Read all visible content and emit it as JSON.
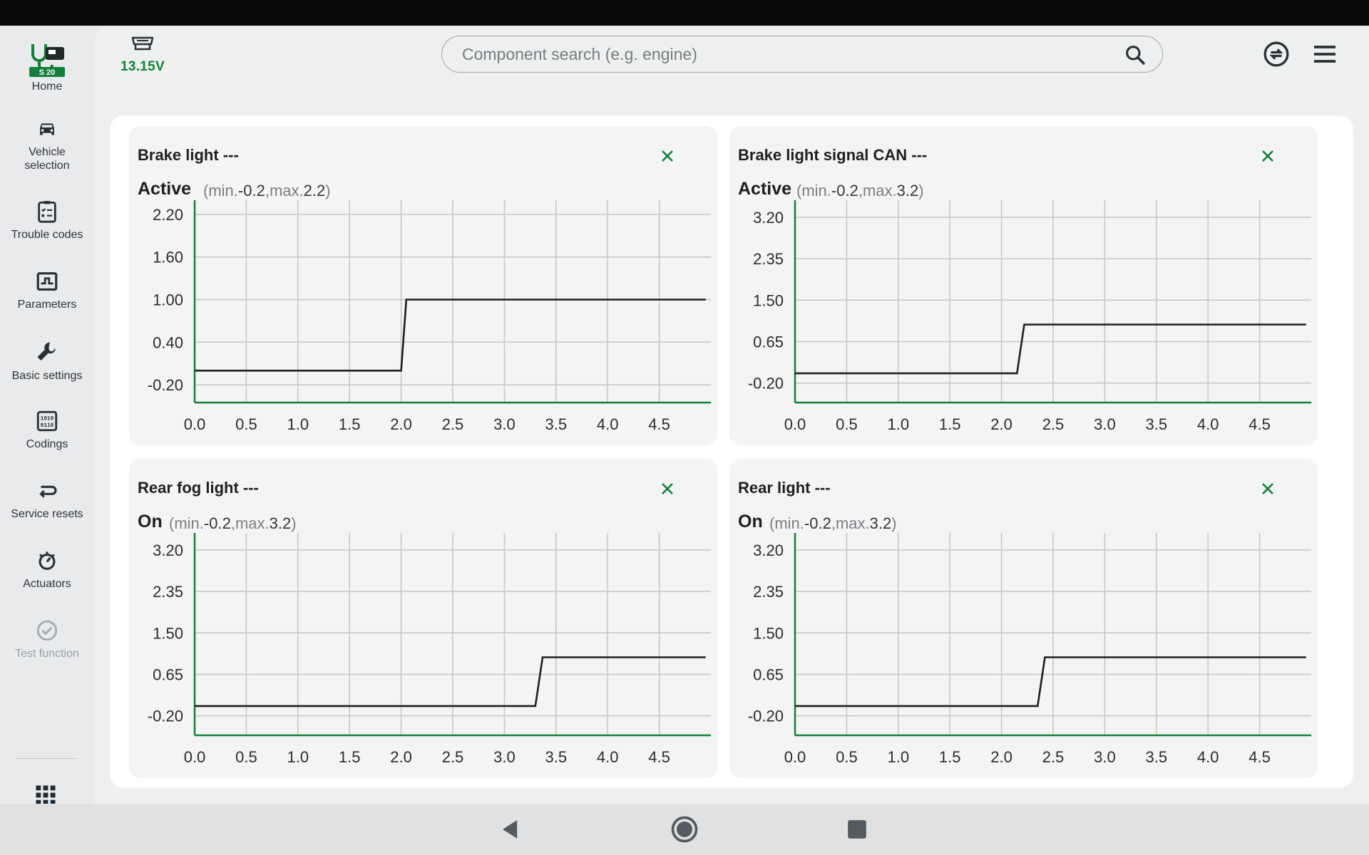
{
  "sidebar": {
    "home": {
      "label": "Home",
      "badge": "S 20"
    },
    "items": [
      {
        "label": "Vehicle\nselection",
        "icon": "car-icon"
      },
      {
        "label": "Trouble codes",
        "icon": "clipboard-checklist-icon"
      },
      {
        "label": "Parameters",
        "icon": "signal-monitor-icon"
      },
      {
        "label": "Basic settings",
        "icon": "wrench-icon"
      },
      {
        "label": "Codings",
        "icon": "binary-chip-icon"
      },
      {
        "label": "Service resets",
        "icon": "return-arrow-icon"
      },
      {
        "label": "Actuators",
        "icon": "actuator-icon"
      },
      {
        "label": "Test function",
        "icon": "check-circle-icon"
      }
    ],
    "apps_icon": "grid-icon"
  },
  "header": {
    "voltage": "13.15V",
    "search_placeholder": "Component search (e.g. engine)"
  },
  "colors": {
    "accent": "#12803a",
    "trace": "#1f1f1f",
    "grid": "#c4c4c4"
  },
  "cards": [
    {
      "title": "Brake light ---",
      "status": "Active",
      "range_min_label": "min.",
      "range_min": "-0.2",
      "range_max_label": "max.",
      "range_max": "2.2",
      "chart_data": {
        "type": "line",
        "xlim": [
          0,
          5
        ],
        "ylim": [
          -0.45,
          2.4
        ],
        "x_ticks": [
          "0.0",
          "0.5",
          "1.0",
          "1.5",
          "2.0",
          "2.5",
          "3.0",
          "3.5",
          "4.0",
          "4.5"
        ],
        "y_ticks": [
          2.2,
          1.6,
          1.0,
          0.4,
          -0.2
        ],
        "y_tick_labels": [
          "2.20",
          "1.60",
          "1.00",
          "0.40",
          "-0.20"
        ],
        "series": [
          {
            "x": [
              0,
              2.0,
              2.05,
              4.95
            ],
            "y": [
              0,
              0,
              1,
              1
            ]
          }
        ]
      }
    },
    {
      "title": "Brake light signal CAN ---",
      "status": "Active",
      "range_min_label": "min.",
      "range_min": "-0.2",
      "range_max_label": "max.",
      "range_max": "3.2",
      "chart_data": {
        "type": "line",
        "xlim": [
          0,
          5
        ],
        "ylim": [
          -0.6,
          3.55
        ],
        "x_ticks": [
          "0.0",
          "0.5",
          "1.0",
          "1.5",
          "2.0",
          "2.5",
          "3.0",
          "3.5",
          "4.0",
          "4.5"
        ],
        "y_ticks": [
          3.2,
          2.35,
          1.5,
          0.65,
          -0.2
        ],
        "y_tick_labels": [
          "3.20",
          "2.35",
          "1.50",
          "0.65",
          "-0.20"
        ],
        "series": [
          {
            "x": [
              0,
              2.15,
              2.22,
              4.95
            ],
            "y": [
              0,
              0,
              1,
              1
            ]
          }
        ]
      }
    },
    {
      "title": "Rear fog light ---",
      "status": "On",
      "range_min_label": "min.",
      "range_min": "-0.2",
      "range_max_label": "max.",
      "range_max": "3.2",
      "chart_data": {
        "type": "line",
        "xlim": [
          0,
          5
        ],
        "ylim": [
          -0.6,
          3.55
        ],
        "x_ticks": [
          "0.0",
          "0.5",
          "1.0",
          "1.5",
          "2.0",
          "2.5",
          "3.0",
          "3.5",
          "4.0",
          "4.5"
        ],
        "y_ticks": [
          3.2,
          2.35,
          1.5,
          0.65,
          -0.2
        ],
        "y_tick_labels": [
          "3.20",
          "2.35",
          "1.50",
          "0.65",
          "-0.20"
        ],
        "series": [
          {
            "x": [
              0,
              3.3,
              3.37,
              4.95
            ],
            "y": [
              0,
              0,
              1,
              1
            ]
          }
        ]
      }
    },
    {
      "title": "Rear light ---",
      "status": "On",
      "range_min_label": "min.",
      "range_min": "-0.2",
      "range_max_label": "max.",
      "range_max": "3.2",
      "chart_data": {
        "type": "line",
        "xlim": [
          0,
          5
        ],
        "ylim": [
          -0.6,
          3.55
        ],
        "x_ticks": [
          "0.0",
          "0.5",
          "1.0",
          "1.5",
          "2.0",
          "2.5",
          "3.0",
          "3.5",
          "4.0",
          "4.5"
        ],
        "y_ticks": [
          3.2,
          2.35,
          1.5,
          0.65,
          -0.2
        ],
        "y_tick_labels": [
          "3.20",
          "2.35",
          "1.50",
          "0.65",
          "-0.20"
        ],
        "series": [
          {
            "x": [
              0,
              2.35,
              2.42,
              4.95
            ],
            "y": [
              0,
              0,
              1,
              1
            ]
          }
        ]
      }
    }
  ],
  "navbar": {
    "back_icon": "back-triangle-icon",
    "home_icon": "home-circle-icon",
    "recents_icon": "recents-square-icon"
  }
}
